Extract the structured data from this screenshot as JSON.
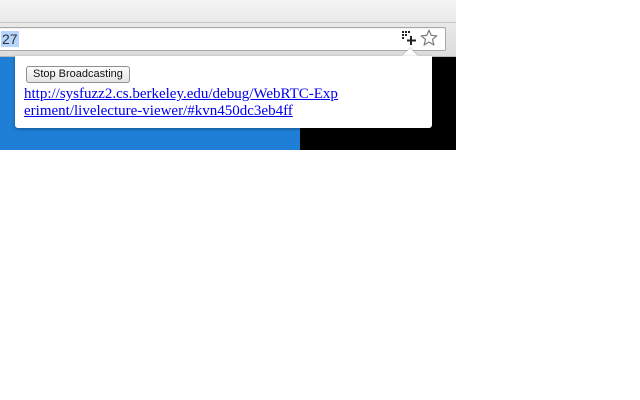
{
  "browser": {
    "omnibox": {
      "visible_text": "27"
    },
    "icons": {
      "cast": "cast-extension-icon",
      "bookmark": "star-icon"
    }
  },
  "popup": {
    "button_label": "Stop Broadcasting",
    "link_text": "http://sysfuzz2.cs.berkeley.edu/debug/WebRTC-Experiment/livelecture-viewer/#kvn450dc3eb4ff"
  },
  "colors": {
    "page_blue": "#1f7fd6",
    "page_black": "#000000",
    "link": "#0000ee",
    "selection": "#b5d5ff"
  }
}
